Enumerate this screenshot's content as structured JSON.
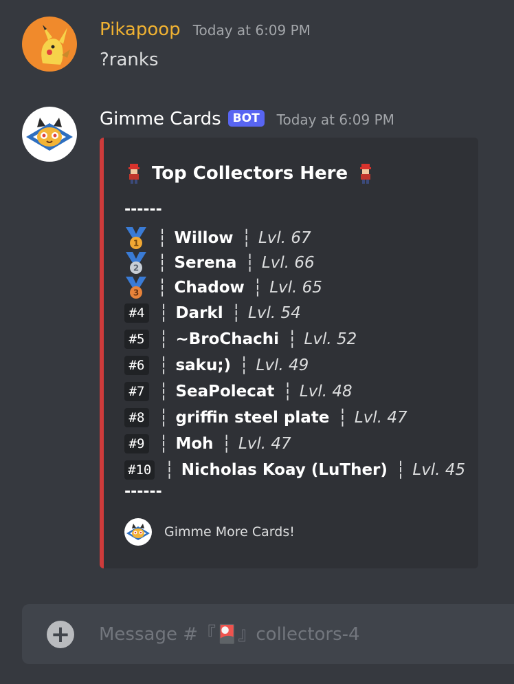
{
  "messages": [
    {
      "username": "Pikapoop",
      "username_color": "#f0b232",
      "timestamp": "Today at 6:09 PM",
      "content": "?ranks",
      "avatar_icon": "pikachu-avatar"
    },
    {
      "username": "Gimme Cards",
      "username_color": "#ffffff",
      "bot_tag": "BOT",
      "timestamp": "Today at 6:09 PM",
      "avatar_icon": "cat-bot-avatar",
      "embed": {
        "accent_color": "#ce3b3b",
        "title": "Top Collectors Here",
        "divider": "------",
        "rows": [
          {
            "rank": "1",
            "medal": "gold-medal-icon",
            "name": "Willow",
            "level": "Lvl. 67"
          },
          {
            "rank": "2",
            "medal": "silver-medal-icon",
            "name": "Serena",
            "level": "Lvl. 66"
          },
          {
            "rank": "3",
            "medal": "bronze-medal-icon",
            "name": "Chadow",
            "level": "Lvl. 65"
          },
          {
            "rank": "#4",
            "name": "Darkl",
            "level": "Lvl. 54"
          },
          {
            "rank": "#5",
            "name": "~BroChachi",
            "level": "Lvl. 52"
          },
          {
            "rank": "#6",
            "name": "saku;)",
            "level": "Lvl. 49"
          },
          {
            "rank": "#7",
            "name": "SeaPolecat",
            "level": "Lvl. 48"
          },
          {
            "rank": "#8",
            "name": "griffin steel plate",
            "level": "Lvl. 47"
          },
          {
            "rank": "#9",
            "name": "Moh",
            "level": "Lvl. 47"
          },
          {
            "rank": "#10",
            "name": "Nicholas Koay (LuTher)",
            "level": "Lvl. 45"
          }
        ],
        "separator": "┆",
        "footer_text": "Gimme More Cards!"
      }
    }
  ],
  "composer": {
    "placeholder": "Message #『🎴』collectors-4",
    "plus_icon": "plus-circle-icon"
  }
}
